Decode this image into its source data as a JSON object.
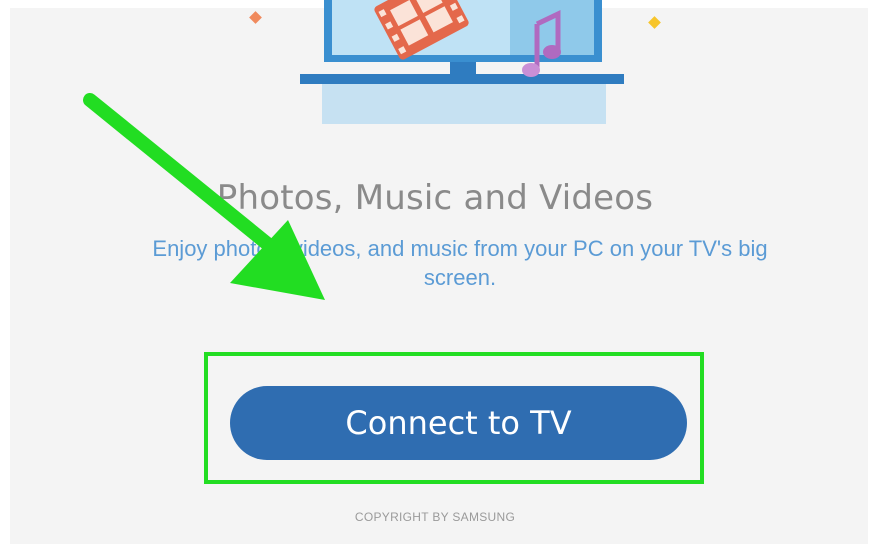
{
  "feature": {
    "title": "Photos, Music and Videos",
    "description": "Enjoy photos, videos, and music from your PC on your TV's big screen."
  },
  "actions": {
    "connect_label": "Connect to TV"
  },
  "footer": {
    "copyright": "COPYRIGHT BY SAMSUNG"
  },
  "annotation": {
    "arrow_color": "#22dd22",
    "highlight_color": "#22dd22"
  },
  "colors": {
    "button": "#2f6db1",
    "description_text": "#5b9bd5",
    "title_text": "#8a8a8a"
  }
}
